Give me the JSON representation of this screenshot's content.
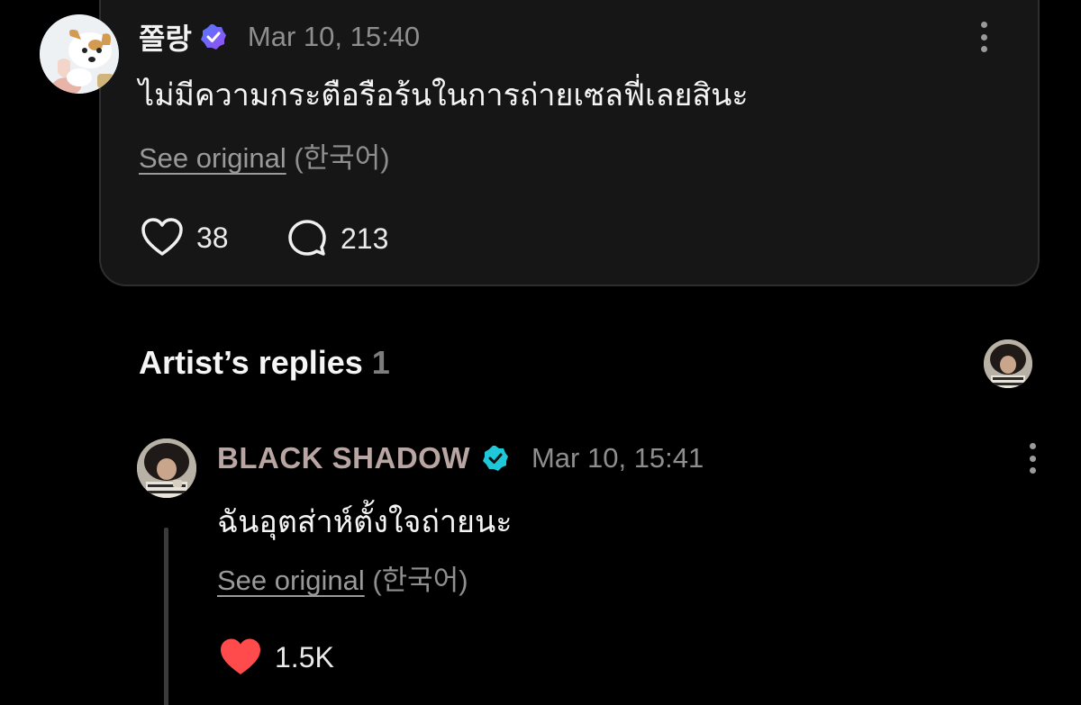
{
  "comment": {
    "author": "쫄랑",
    "timestamp": "Mar 10, 15:40",
    "text": "ไม่มีความกระตือรือร้นในการถ่ายเซลฟี่เลยสินะ",
    "see_original": "See original",
    "language": "(한국어)",
    "likes": "38",
    "replies": "213"
  },
  "section": {
    "title": "Artist’s replies",
    "count": "1"
  },
  "reply": {
    "author": "BLACK SHADOW",
    "timestamp": "Mar 10, 15:41",
    "text": "ฉันอุตส่าห์ตั้งใจถ่ายนะ",
    "see_original": "See original",
    "language": "(한국어)",
    "likes": "1.5K"
  },
  "colors": {
    "background": "#000000",
    "card": "#161616",
    "badge_purple": "#6b5cf6",
    "badge_cyan": "#1ec8d8",
    "liked_heart": "#ff4b4b",
    "artist_name": "#b9a6a2"
  },
  "icons": [
    "heart-outline-icon",
    "comment-bubble-icon",
    "verified-badge-icon",
    "kebab-menu-icon",
    "heart-filled-icon"
  ]
}
